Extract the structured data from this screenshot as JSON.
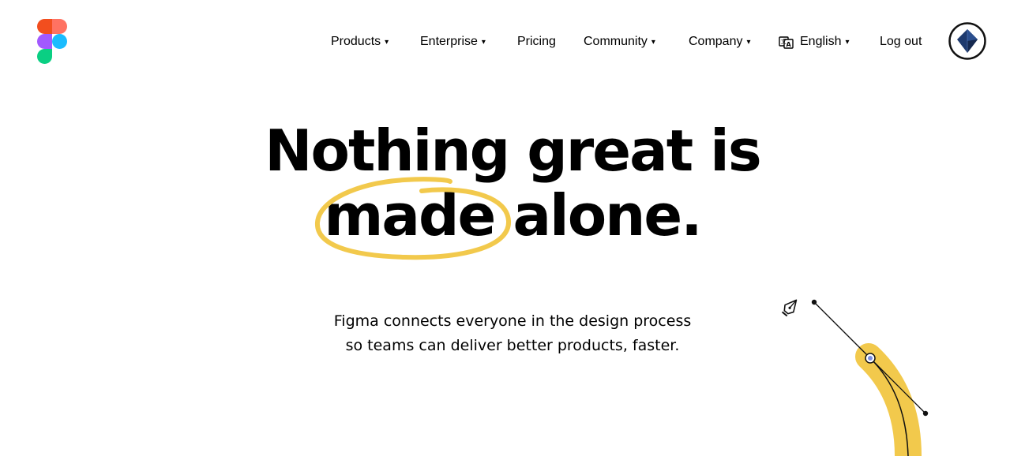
{
  "colors": {
    "logo_red": "#f24e1e",
    "logo_coral": "#ff7262",
    "logo_purple": "#a259ff",
    "logo_blue": "#1abcfe",
    "logo_green": "#0acf83",
    "highlight_yellow": "#f2c94c",
    "avatar_blue": "#1e3a6e"
  },
  "header": {
    "logo_icon": "figma-logo",
    "nav": {
      "products": "Products",
      "enterprise": "Enterprise",
      "pricing": "Pricing",
      "community": "Community",
      "company": "Company",
      "language": "English",
      "logout": "Log out"
    },
    "caret": "▾",
    "language_icon": "translate-icon",
    "avatar_icon": "user-avatar"
  },
  "hero": {
    "headline_line1": "Nothing great is",
    "headline_line2": "made alone.",
    "sub_line1": "Figma connects everyone in the design process",
    "sub_line2": "so teams can deliver better products, faster."
  },
  "decoration": {
    "pen_icon": "pen-tool-icon"
  }
}
